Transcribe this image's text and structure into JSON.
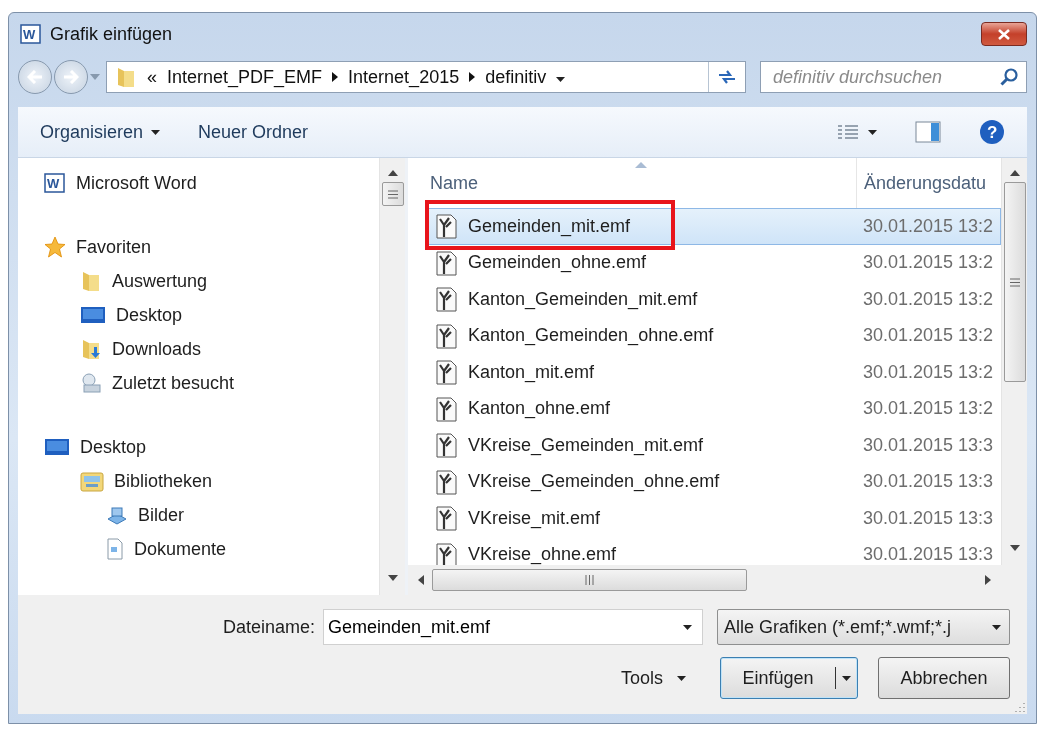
{
  "window": {
    "title": "Grafik einfügen",
    "icon_letter": "W"
  },
  "address": {
    "overflow": "«",
    "path": [
      "Internet_PDF_EMF",
      "Internet_2015",
      "definitiv"
    ]
  },
  "search": {
    "placeholder": "definitiv durchsuchen"
  },
  "toolbar": {
    "organize": "Organisieren",
    "new_folder": "Neuer Ordner",
    "help": "?"
  },
  "navigation": [
    {
      "label": "Microsoft Word",
      "kind": "word",
      "icon_letter": "W"
    },
    {
      "label": "Favoriten",
      "kind": "star",
      "children": [
        {
          "label": "Auswertung",
          "kind": "folder"
        },
        {
          "label": "Desktop",
          "kind": "desktop"
        },
        {
          "label": "Downloads",
          "kind": "downloads"
        },
        {
          "label": "Zuletzt besucht",
          "kind": "recent"
        }
      ]
    },
    {
      "label": "Desktop",
      "kind": "desktop",
      "children": [
        {
          "label": "Bibliotheken",
          "kind": "library",
          "children": [
            {
              "label": "Bilder",
              "kind": "pictures"
            },
            {
              "label": "Dokumente",
              "kind": "documents"
            }
          ]
        }
      ]
    }
  ],
  "file_list": {
    "columns": [
      "Name",
      "Änderungsdatu"
    ],
    "rows": [
      {
        "name": "Gemeinden_mit.emf",
        "date": "30.01.2015 13:2",
        "selected": true,
        "highlighted": true
      },
      {
        "name": "Gemeinden_ohne.emf",
        "date": "30.01.2015 13:2",
        "selected": false,
        "highlighted": false
      },
      {
        "name": "Kanton_Gemeinden_mit.emf",
        "date": "30.01.2015 13:2",
        "selected": false,
        "highlighted": false
      },
      {
        "name": "Kanton_Gemeinden_ohne.emf",
        "date": "30.01.2015 13:2",
        "selected": false,
        "highlighted": false
      },
      {
        "name": "Kanton_mit.emf",
        "date": "30.01.2015 13:2",
        "selected": false,
        "highlighted": false
      },
      {
        "name": "Kanton_ohne.emf",
        "date": "30.01.2015 13:2",
        "selected": false,
        "highlighted": false
      },
      {
        "name": "VKreise_Gemeinden_mit.emf",
        "date": "30.01.2015 13:3",
        "selected": false,
        "highlighted": false
      },
      {
        "name": "VKreise_Gemeinden_ohne.emf",
        "date": "30.01.2015 13:3",
        "selected": false,
        "highlighted": false
      },
      {
        "name": "VKreise_mit.emf",
        "date": "30.01.2015 13:3",
        "selected": false,
        "highlighted": false
      },
      {
        "name": "VKreise_ohne.emf",
        "date": "30.01.2015 13:3",
        "selected": false,
        "highlighted": false
      }
    ]
  },
  "footer": {
    "filename_label": "Dateiname:",
    "filename": "Gemeinden_mit.emf",
    "filetype": "Alle Grafiken (*.emf;*.wmf;*.j",
    "tools": "Tools",
    "insert": "Einfügen",
    "cancel": "Abbrechen"
  }
}
